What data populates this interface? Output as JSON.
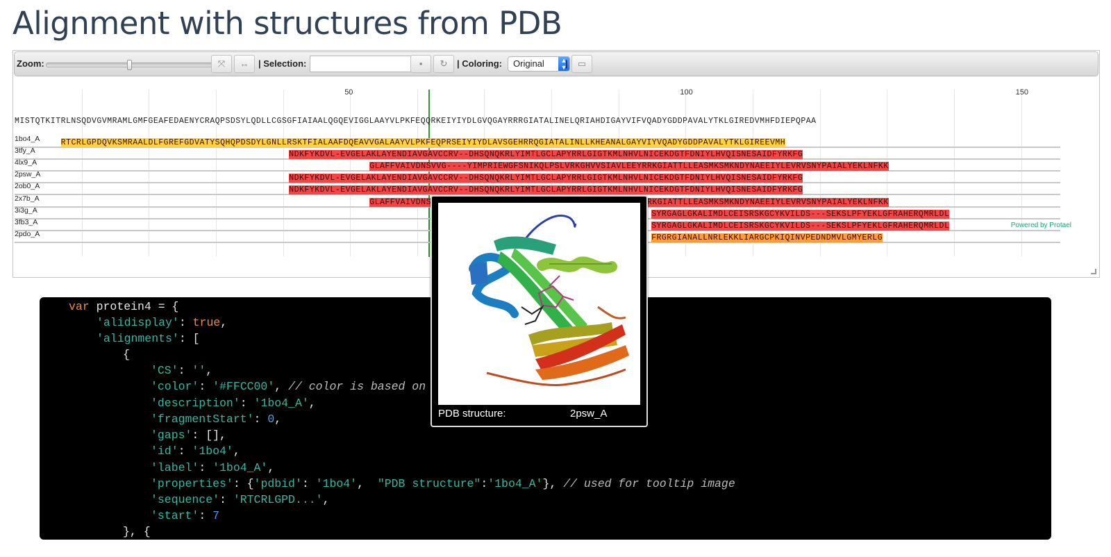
{
  "page": {
    "title": "Alignment with structures from PDB"
  },
  "toolbar": {
    "zoom_label": "Zoom:",
    "zoom_level": 0.5,
    "selection_label": "| Selection:",
    "selection_value": "",
    "coloring_label": "| Coloring:",
    "coloring_selected": "Original",
    "separator": "|",
    "icons": [
      "fit-to-screen-icon",
      "fit-width-icon",
      "save-icon",
      "refresh-icon",
      "image-export-icon"
    ]
  },
  "ruler": {
    "ticks": [
      "50",
      "100",
      "150"
    ]
  },
  "query_sequence": "MISTQTKITRLNSQDVGVMRAMLGMFGEAFEDAENYCRAQPSDSYLQDLLCGSGFIAIAALQGQEVIGGLAAYVLPKFEQQRKEIYIYDLGVQGAYRRRGIATALINELQRIAHDIGAYVIFVQADYGDDPAVALYTKLGIREDVMHFDIEPQPAA",
  "alignments": [
    {
      "label": "1bo4_A",
      "color": "#ffd23a",
      "sequence": "RTCRLGPDQVKSMRAALDLFGREFGDVATYSQHQPDSDYLGNLLRSKTFIALAAFDQEAVVGALAAYVLPKFEQPRSEIYIYDLAVSGEHRRQGIATALINLLKHEANALGAYVIYVQADYGDDPAVALYTKLGIREEVMH"
    },
    {
      "label": "3tfy_A",
      "color": "#f24545",
      "sequence": "NDKFYKDVL-EVGELAKLAYENDIAVGAVCCRV--DHSQNQKRLYIMTLGCLAPYRRLGIGTKMLNHVLNICEKDGTFDNIYLHVQISNESAIDFYRKFG"
    },
    {
      "label": "4lx9_A",
      "color": "#f24545",
      "sequence": "GLAFFVAIVDNSVVG----YIMPRIEWGFSNIKQLPSLVRKGHVVSIAVLEEYRRKGIATTLLEASMKSMKNDYNAEEIYLEVRVSNYPAIALYEKLNFKK"
    },
    {
      "label": "2psw_A",
      "color": "#f24545",
      "sequence": "NDKFYKDVL-EVGELAKLAYENDIAVGAVCCRV--DHSQNQKRLYIMTLGCLAPYRRLGIGTKMLNHVLNICEKDGTFDNIYLHVQISNESAIDFYRKFG"
    },
    {
      "label": "2ob0_A",
      "color": "#f24545",
      "sequence": "NDKFYKDVL-EVGELAKLAYENDIAVGAVCCRV--DHSQNQKRLYIMTLGCLAPYRRLGIGTKMLNHVLNICEKDGTFDNIYLHVQISNESAIDFYRKFG"
    },
    {
      "label": "2x7b_A",
      "color": "#f24545",
      "sequence": "GLAFFVAIVDNSVVG----YIMPRIEWGFSNIKQLPSLVRKGHVVSIAVLEEYRRKGIATTLLEASMKSMKNDYNAEEIYLEVRVSNYPAIALYEKLNFKK"
    },
    {
      "label": "3i3g_A",
      "color": "#f24545",
      "sequence": "SYRGAGLGKALIMDLCEISRSKGCYKVILDS---SEKSLPFYEKLGFRAHERQMRLDL"
    },
    {
      "label": "3fb3_A",
      "color": "#f24545",
      "sequence": "SYRGAGLGKALIMDLCEISRSKGCYKVILDS---SEKSLPFYEKLGFRAHERQMRLDL"
    },
    {
      "label": "2pdo_A",
      "color": "#ff9d3a",
      "sequence": "FRGRGIANALLNRLEKKLIARGCPKIQINVPEDNDMVLGMYERLG"
    }
  ],
  "powered_by": "Powered by Protael",
  "tooltip": {
    "caption_key": "PDB structure:",
    "caption_value": "2psw_A"
  },
  "code": {
    "var_keyword": "var",
    "var_decl": " protein4 = {",
    "alidisplay_key": "'alidisplay'",
    "alidisplay_value": "true",
    "alignments_key": "'alignments'",
    "cs_key": "'CS'",
    "cs_value": "''",
    "color_key": "'color'",
    "color_value": "'#FFCC00'",
    "color_comment": "// color is based on",
    "description_key": "'description'",
    "description_value": "'1bo4_A'",
    "fragmentStart_key": "'fragmentStart'",
    "fragmentStart_value": "0",
    "gaps_key": "'gaps'",
    "gaps_value": "[]",
    "id_key": "'id'",
    "id_value": "'1bo4'",
    "label_key": "'label'",
    "label_value": "'1bo4_A'",
    "properties_key": "'properties'",
    "pdbid_key": "'pdbid'",
    "pdbid_value": "'1bo4'",
    "pdbstruct_key": "\"PDB structure\"",
    "pdbstruct_value": "'1bo4_A'",
    "properties_comment": "// used for tooltip image",
    "sequence_key": "'sequence'",
    "sequence_value": "'RTCRLGPD...'",
    "start_key": "'start'",
    "start_value": "7",
    "closing": "}, {"
  }
}
